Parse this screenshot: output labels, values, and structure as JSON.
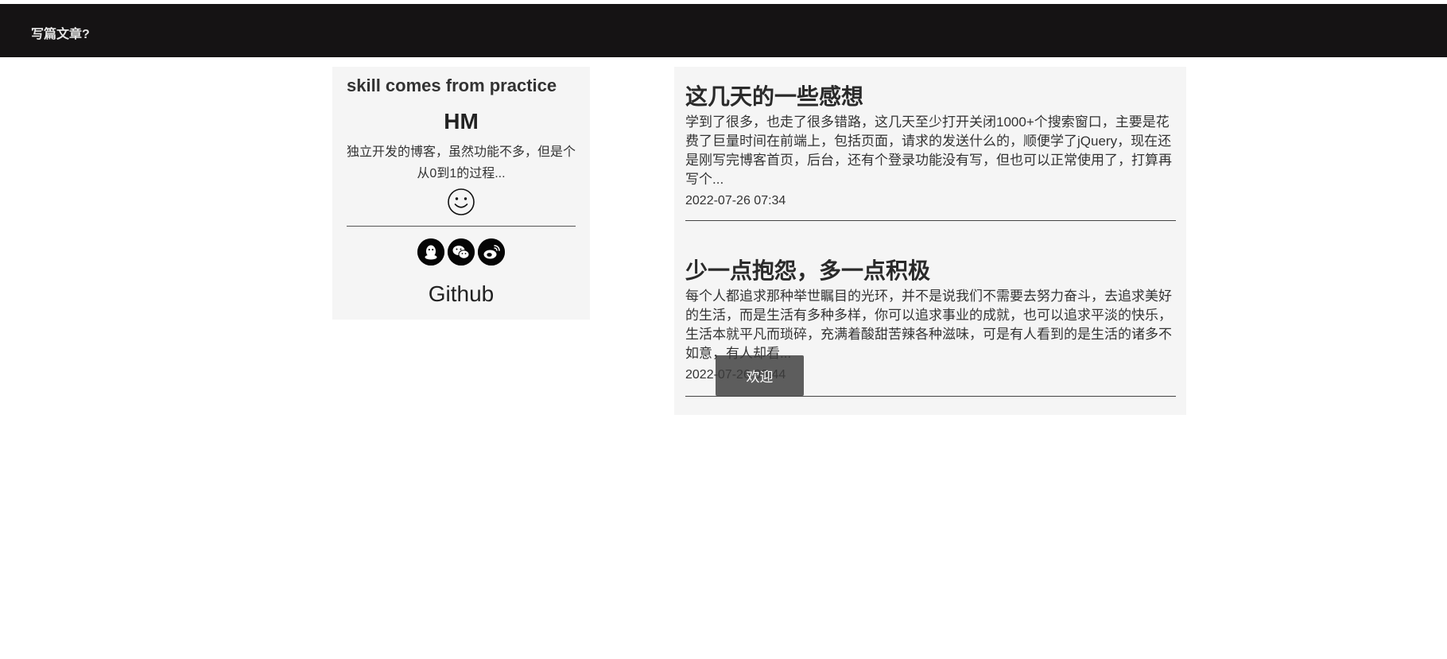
{
  "nav": {
    "write_link": "写篇文章?"
  },
  "profile": {
    "motto": "skill comes from practice",
    "name": "HM",
    "description": "独立开发的博客，虽然功能不多，但是个从0到1的过程...",
    "avatar_icon": "smiley-face-icon",
    "social_icons": [
      "qq-icon",
      "wechat-icon",
      "weibo-icon"
    ],
    "github_label": "Github"
  },
  "articles": [
    {
      "title": "这几天的一些感想",
      "summary": "学到了很多，也走了很多错路，这几天至少打开关闭1000+个搜索窗口，主要是花费了巨量时间在前端上，包括页面，请求的发送什么的，顺便学了jQuery，现在还是刚写完博客首页，后台，还有个登录功能没有写，但也可以正常使用了，打算再写个...",
      "date": "2022-07-26 07:34"
    },
    {
      "title": "少一点抱怨，多一点积极",
      "summary": "每个人都追求那种举世瞩目的光环，并不是说我们不需要去努力奋斗，去追求美好的生活，而是生活有多种多样，你可以追求事业的成就，也可以追求平淡的快乐，生活本就平凡而琐碎，充满着酸甜苦辣各种滋味，可是有人看到的是生活的诸多不如意，有人却看...",
      "date": "2022-07-26 08:44"
    }
  ],
  "toast": {
    "message": "欢迎"
  },
  "colors": {
    "navbar": "#151314",
    "card_bg": "#f5f5f5",
    "icon_bg": "#050505"
  }
}
